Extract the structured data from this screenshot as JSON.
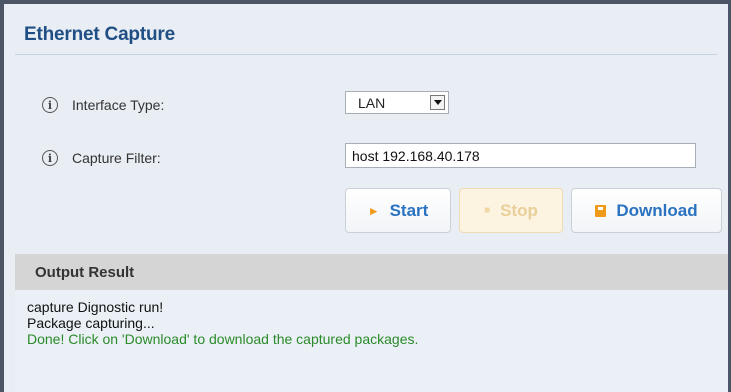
{
  "panel": {
    "title": "Ethernet Capture"
  },
  "form": {
    "interface_label": "Interface Type:",
    "interface_value": "LAN",
    "filter_label": "Capture Filter:",
    "filter_value": "host 192.168.40.178"
  },
  "buttons": {
    "start_label": "Start",
    "stop_label": "Stop",
    "download_label": "Download"
  },
  "output": {
    "header": "Output Result",
    "lines": [
      "capture Dignostic run!",
      "Package capturing...",
      "Done! Click on 'Download' to download the captured packages."
    ]
  },
  "colors": {
    "title": "#1f4f85",
    "button_text": "#2a73c0",
    "button_icon": "#f09a1a",
    "done_text": "#2b8a2b",
    "output_header_bg": "#d5d5d5"
  },
  "icons": {
    "info": "info-circle-icon",
    "start": "play-icon",
    "stop": "stop-icon",
    "download": "save-icon",
    "dropdown": "chevron-down-icon"
  }
}
